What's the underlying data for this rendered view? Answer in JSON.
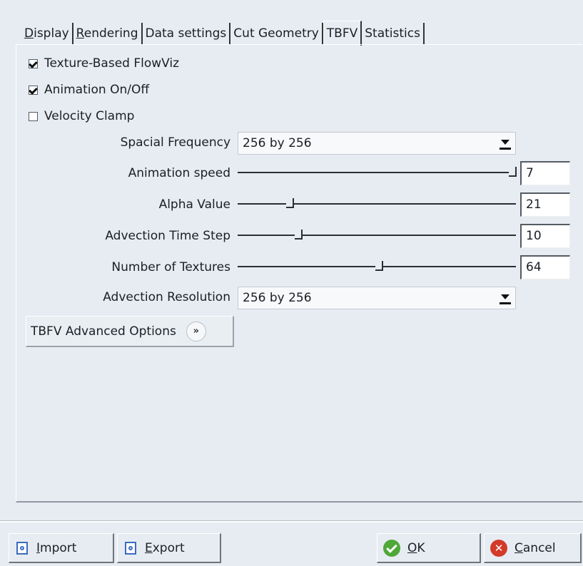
{
  "tabs": [
    {
      "mnemonic": "D",
      "rest": "isplay"
    },
    {
      "mnemonic": "R",
      "rest": "endering"
    },
    {
      "mnemonic": "",
      "rest": "Data settings"
    },
    {
      "mnemonic": "",
      "rest": "Cut Geometry"
    },
    {
      "mnemonic": "",
      "rest": "TBFV"
    },
    {
      "mnemonic": "",
      "rest": "Statistics"
    }
  ],
  "active_tab": "TBFV",
  "checkboxes": {
    "tbfv": {
      "label": "Texture-Based FlowViz",
      "checked": true
    },
    "animation": {
      "label": "Animation On/Off",
      "checked": true
    },
    "velocity_clamp": {
      "label": "Velocity Clamp",
      "checked": false
    }
  },
  "spacial_frequency": {
    "label": "Spacial Frequency",
    "value": "256 by 256"
  },
  "animation_speed": {
    "label": "Animation speed",
    "value": "7",
    "fraction": 0.99
  },
  "alpha_value": {
    "label": "Alpha Value",
    "value": "21",
    "fraction": 0.19
  },
  "advection_time_step": {
    "label": "Advection Time Step",
    "value": "10",
    "fraction": 0.22
  },
  "number_of_textures": {
    "label": "Number of Textures",
    "value": "64",
    "fraction": 0.51
  },
  "advection_resolution": {
    "label": "Advection Resolution",
    "value": "256 by 256"
  },
  "advanced_button": {
    "label": "TBFV Advanced Options",
    "icon_text": "»",
    "icon": "double-chevron-right-icon"
  },
  "footer": {
    "import": {
      "mnemonic": "I",
      "rest": "mport",
      "icon": "import-icon"
    },
    "export": {
      "mnemonic": "E",
      "rest": "xport",
      "icon": "export-icon"
    },
    "ok": {
      "mnemonic": "O",
      "rest": "K",
      "icon": "check-circle-icon"
    },
    "cancel": {
      "mnemonic": "C",
      "rest": "ancel",
      "icon": "cancel-circle-icon"
    }
  },
  "colors": {
    "background": "#e7ecf2",
    "ok_green": "#4fa838",
    "cancel_red": "#d23a2a",
    "icon_blue": "#3b6bbf"
  }
}
